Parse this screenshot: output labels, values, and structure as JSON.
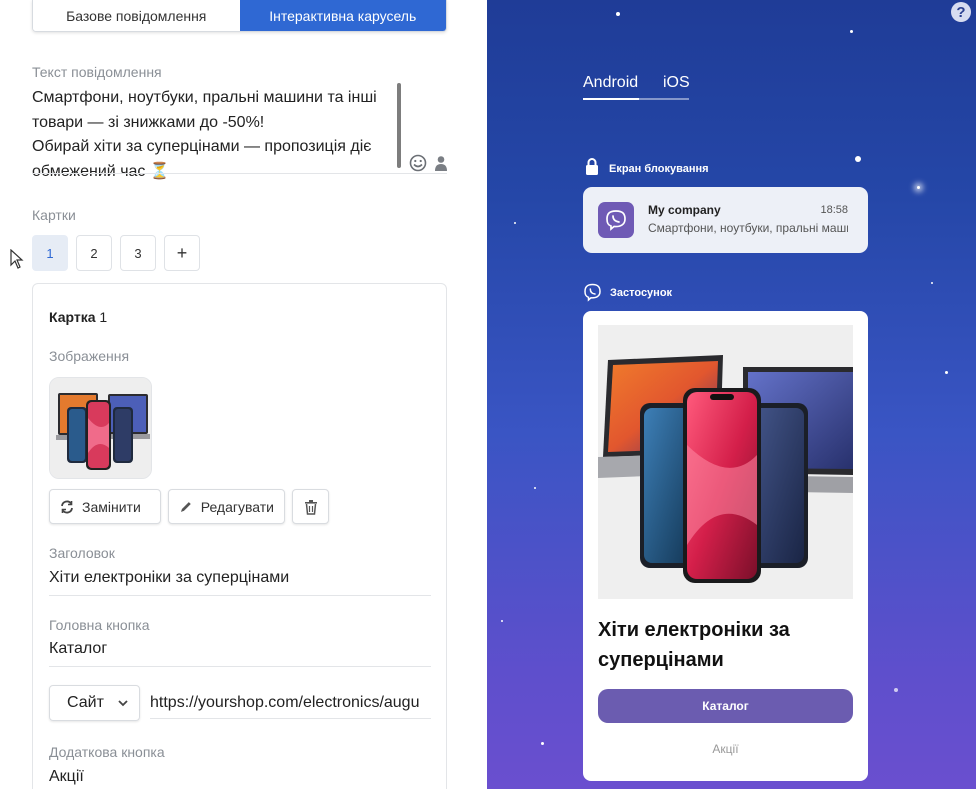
{
  "message_type_tabs": [
    "Базове повідомлення",
    "Інтерактивна карусель"
  ],
  "message_text": {
    "label": "Текст повідомлення",
    "lines": [
      "Смартфони, ноутбуки, пральні машини та інші",
      "товари — зі знижками до -50%!",
      "Обирай хіти за суперцінами — пропозиція діє",
      "обмежений час ⏳"
    ]
  },
  "cards_section": {
    "label": "Картки",
    "tabs": [
      "1",
      "2",
      "3",
      "+"
    ]
  },
  "card": {
    "title_bold": "Картка",
    "title_number": "1",
    "image_label": "Зображення",
    "replace_label": "Замінити",
    "edit_label": "Редагувати",
    "heading_label": "Заголовок",
    "heading_value": "Хіти електроніки за суперцінами",
    "main_button_label": "Головна кнопка",
    "main_button_value": "Каталог",
    "link_type": "Сайт",
    "link_url": "https://yourshop.com/electronics/augu",
    "extra_button_label": "Додаткова кнопка",
    "extra_button_value": "Акції"
  },
  "preview": {
    "os_tabs": [
      "Android",
      "iOS"
    ],
    "help": "?",
    "lock_screen_label": "Екран блокування",
    "lock_company": "My company",
    "lock_time": "18:58",
    "lock_message": "Смартфони, ноутбуки, пральні машини",
    "app_label": "Застосунок",
    "app_title": "Хіти електроніки за суперцінами",
    "app_main_button": "Каталог",
    "app_secondary_button": "Акції"
  },
  "colors": {
    "accent": "#2f68d3",
    "viber_purple": "#6f5ab5",
    "preview_bg_top": "#1f3c97",
    "preview_bg_bottom": "#6a4fcf"
  }
}
